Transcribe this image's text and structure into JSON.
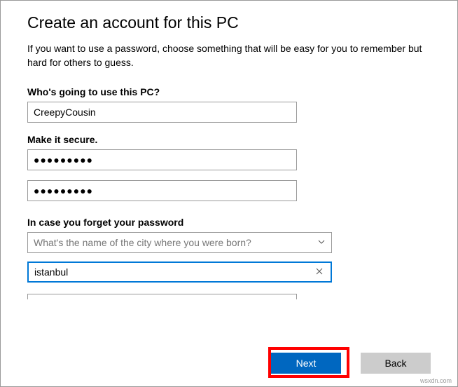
{
  "title": "Create an account for this PC",
  "description": "If you want to use a password, choose something that will be easy for you to remember but hard for others to guess.",
  "labels": {
    "who": "Who's going to use this PC?",
    "secure": "Make it secure.",
    "forgot": "In case you forget your password"
  },
  "fields": {
    "username": "CreepyCousin",
    "password1": "●●●●●●●●●",
    "password2": "●●●●●●●●●",
    "security_question": "What's the name of the city where you were born?",
    "security_answer": "istanbul"
  },
  "buttons": {
    "next": "Next",
    "back": "Back"
  },
  "attribution": "wsxdn.com"
}
